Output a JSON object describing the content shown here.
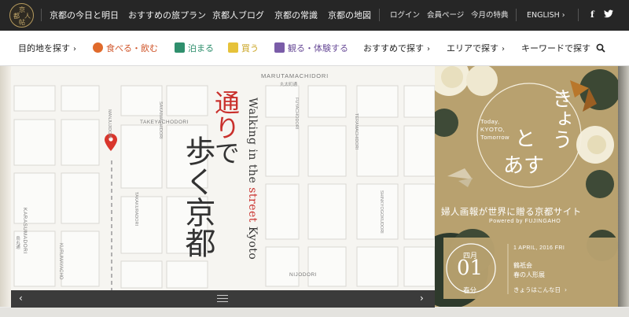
{
  "topbar": {
    "logo_chars": [
      "京",
      "都",
      "人",
      "帖"
    ],
    "nav": [
      "京都の今日と明日",
      "おすすめの旅プラン",
      "京都人ブログ",
      "京都の常識",
      "京都の地図"
    ],
    "login": "ログイン",
    "member": "会員ページ",
    "perk": "今月の特典",
    "language": "ENGLISH",
    "facebook": "f",
    "twitter": "t"
  },
  "navbar": {
    "destination": "目的地を探す",
    "eat": "食べる・飲む",
    "stay": "泊まる",
    "buy": "買う",
    "see": "観る・体験する",
    "recommend": "おすすめで探す",
    "area": "エリアで探す",
    "keyword": "キーワードで探す"
  },
  "hero": {
    "title_red": "通り",
    "title_rest": "で",
    "title_line2": "歩く京都",
    "subtitle_a": "Walking in the",
    "subtitle_b": "street",
    "subtitle_c": "Kyoto",
    "streets": {
      "marutamachi": "MARUTAMACHIDORI",
      "marutamachi_jp": "丸太町通",
      "takeyacho": "TAKEYACHODORI",
      "fuyacho": "FUYACHODORI",
      "teramachi": "TERAMACHIDORI",
      "shinkyogoku": "SHINKYOGOKUDORI",
      "nijo": "NIJODORI",
      "karasuma": "KARASUMADORI",
      "karasuma_jp": "烏丸通",
      "kurumaya": "KURUMAYACHO",
      "takakura": "TAKAKURADORI",
      "sakaimachi": "SAKAIMACHIDORI",
      "manjuji": "MANJUJIDORI"
    },
    "prev": "‹",
    "next": "›"
  },
  "panel": {
    "title": [
      "きょう",
      "と",
      "あす"
    ],
    "tagline": [
      "Today,",
      "KYOTO,",
      "Tomorrow"
    ],
    "subtitle": "婦人画報が世界に贈る京都サイト",
    "powered": "Powered by FUJINGAHO",
    "month": "四月",
    "day": "01",
    "season": "春分",
    "date": "1 APRIL, 2016 FRI",
    "event_place": "鶴祇会",
    "event_name": "春の人形展",
    "button": "きょうはこんな日"
  },
  "colors": {
    "topbar_bg": "#262626",
    "accent_red": "#c9302c",
    "panel_gold": "#b8a16f",
    "eat_icon": "#e06a2b",
    "stay_icon": "#2f8f6d",
    "buy_icon": "#e6c23a",
    "see_icon": "#7a5ca8"
  }
}
